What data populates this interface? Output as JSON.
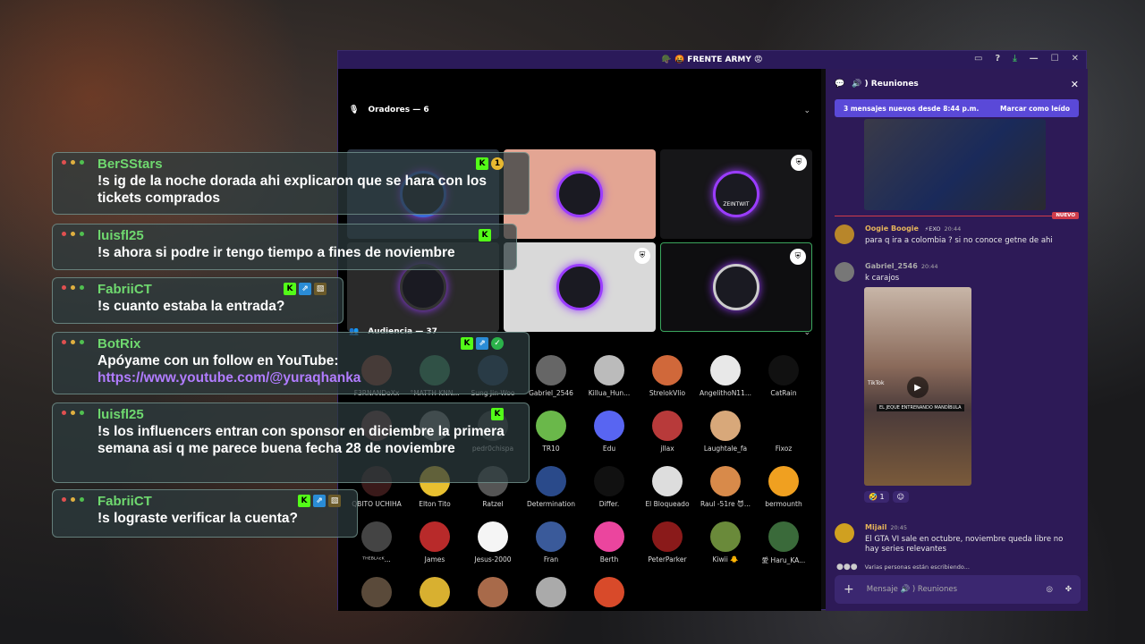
{
  "window": {
    "title": "🪖 🤬 FRENTE ARMY 😡",
    "controls": [
      "▭",
      "?",
      "⤓",
      "—",
      "☐",
      "✕"
    ]
  },
  "stage": {
    "speakers_label": "Oradores — 6",
    "audience_label": "Audiencia — 37",
    "speaker_tiles": [
      {
        "bg": "#2a3340",
        "ring": "#3a6ad8"
      },
      {
        "bg": "#e3a593",
        "ring": "#9a3cff"
      },
      {
        "bg": "#161618",
        "ring": "#9a3cff",
        "text": "ZEINTWIT"
      },
      {
        "bg": "#2a2a2a",
        "ring": "#333"
      },
      {
        "bg": "#d9d9d9",
        "ring": "#9a3cff"
      },
      {
        "bg": "#0e0e10",
        "ring": "#ccc"
      }
    ],
    "audience": [
      {
        "name": "F3RNANDoXx",
        "color": "#8a3a2a"
      },
      {
        "name": "°MATTH KNN...",
        "color": "#3a8a5a"
      },
      {
        "name": "Sung Jin-Woo",
        "color": "#233a5a"
      },
      {
        "name": "Gabriel_2546",
        "color": "#666"
      },
      {
        "name": "Killua_Hun...",
        "color": "#bbb"
      },
      {
        "name": "StrelokVlio",
        "color": "#d0683a"
      },
      {
        "name": "AngelithoN11...",
        "color": "#e8e8e8"
      },
      {
        "name": "CatRain",
        "color": "#111"
      },
      {
        "name": "",
        "color": "#6a3a3a"
      },
      {
        "name": "",
        "color": "#777"
      },
      {
        "name": "pedr0chispa",
        "color": "#3a3a3a"
      },
      {
        "name": "TR10",
        "color": "#6ab84a"
      },
      {
        "name": "Edu",
        "color": "#5865f2"
      },
      {
        "name": "jllax",
        "color": "#b83a3a"
      },
      {
        "name": "Laughtale_fa",
        "color": "#d8a87a"
      },
      {
        "name": "Fixoz",
        "color": "#000"
      },
      {
        "name": "QBITO UCHIHA",
        "color": "#3a1a1a"
      },
      {
        "name": "Elton Tito",
        "color": "#e8c030"
      },
      {
        "name": "Ratzel",
        "color": "#555"
      },
      {
        "name": "Determination",
        "color": "#2a4a8a"
      },
      {
        "name": "Differ.",
        "color": "#111"
      },
      {
        "name": "El Bloqueado",
        "color": "#ddd"
      },
      {
        "name": "Raul -51re 😈...",
        "color": "#d88a4a"
      },
      {
        "name": "bermounth",
        "color": "#f0a020"
      },
      {
        "name": "ᵀᴴᴱᴮᴸᴬᶜᴷ...",
        "color": "#444"
      },
      {
        "name": "James",
        "color": "#b82a2a"
      },
      {
        "name": "Jesus-2000",
        "color": "#f5f5f5"
      },
      {
        "name": "Fran",
        "color": "#3a5a9a"
      },
      {
        "name": "Berth",
        "color": "#eb459e"
      },
      {
        "name": "PeterParker",
        "color": "#8a1a1a"
      },
      {
        "name": "Kiwii 🐥",
        "color": "#6a8a3a"
      },
      {
        "name": "愛 Haru_KA...",
        "color": "#3a6a3a"
      },
      {
        "name": "",
        "color": "#5a4a3a"
      },
      {
        "name": "",
        "color": "#d8b030"
      },
      {
        "name": "",
        "color": "#a86a4a"
      },
      {
        "name": "",
        "color": "#aaa"
      },
      {
        "name": "",
        "color": "#d84a2a"
      }
    ]
  },
  "chat": {
    "channel": "🔊 ) Reuniones",
    "banner_left": "3 mensajes nuevos desde 8:44 p.m.",
    "banner_right": "Marcar como leído",
    "new_tag": "NUEVO",
    "messages": [
      {
        "name": "Oogie Boogie",
        "tag": "⚡EXO",
        "time": "20:44",
        "text": "para q ira a colombia ? si no conoce getne de ahi",
        "name_color": "#e5b45a"
      },
      {
        "name": "Gabriel_2546",
        "tag": "",
        "time": "20:44",
        "text": "k carajos",
        "name_color": "#aaa"
      },
      {
        "name": "Mijail",
        "tag": "",
        "time": "20:45",
        "text": "El GTA VI sale en octubre, noviembre queda libre no hay series relevantes",
        "name_color": "#e5b45a"
      }
    ],
    "tiktok_caption": "EL JEQUE ENTRENANDO MANDÍBULA",
    "tiktok_label": "TikTok",
    "reaction_count": "1",
    "typing": "Varias personas están escribiendo...",
    "input_placeholder": "Mensaje 🔊 ) Reuniones"
  },
  "overlay": [
    {
      "user": "BerSStars",
      "text": "!s ig de la noche dorada ahi explicaron que se hara con los tickets comprados",
      "badges": [
        "K",
        "gold"
      ]
    },
    {
      "user": "luisfl25",
      "text": "!s ahora si podre ir tengo tiempo a fines de noviembre",
      "badges": [
        "K"
      ]
    },
    {
      "user": "FabriiCT",
      "text": "!s cuanto estaba la entrada?",
      "badges": [
        "K",
        "blue",
        "pic"
      ]
    },
    {
      "user": "BotRix",
      "text": "Apóyame con un follow en YouTube:",
      "link": "https://www.youtube.com/@yuraqhanka",
      "badges": [
        "K",
        "blue",
        "green"
      ]
    },
    {
      "user": "luisfl25",
      "text": "!s los influencers entran con sponsor en diciembre la primera semana asi q me parece buena fecha 28 de noviembre",
      "badges": [
        "K"
      ]
    },
    {
      "user": "FabriiCT",
      "text": "!s lograste verificar la cuenta?",
      "badges": [
        "K",
        "blue",
        "pic"
      ]
    }
  ],
  "colors": {
    "discord_purple": "#2d1a57",
    "kick_green": "#53fc18",
    "username_green": "#6fd96f",
    "link_purple": "#b17cff"
  }
}
